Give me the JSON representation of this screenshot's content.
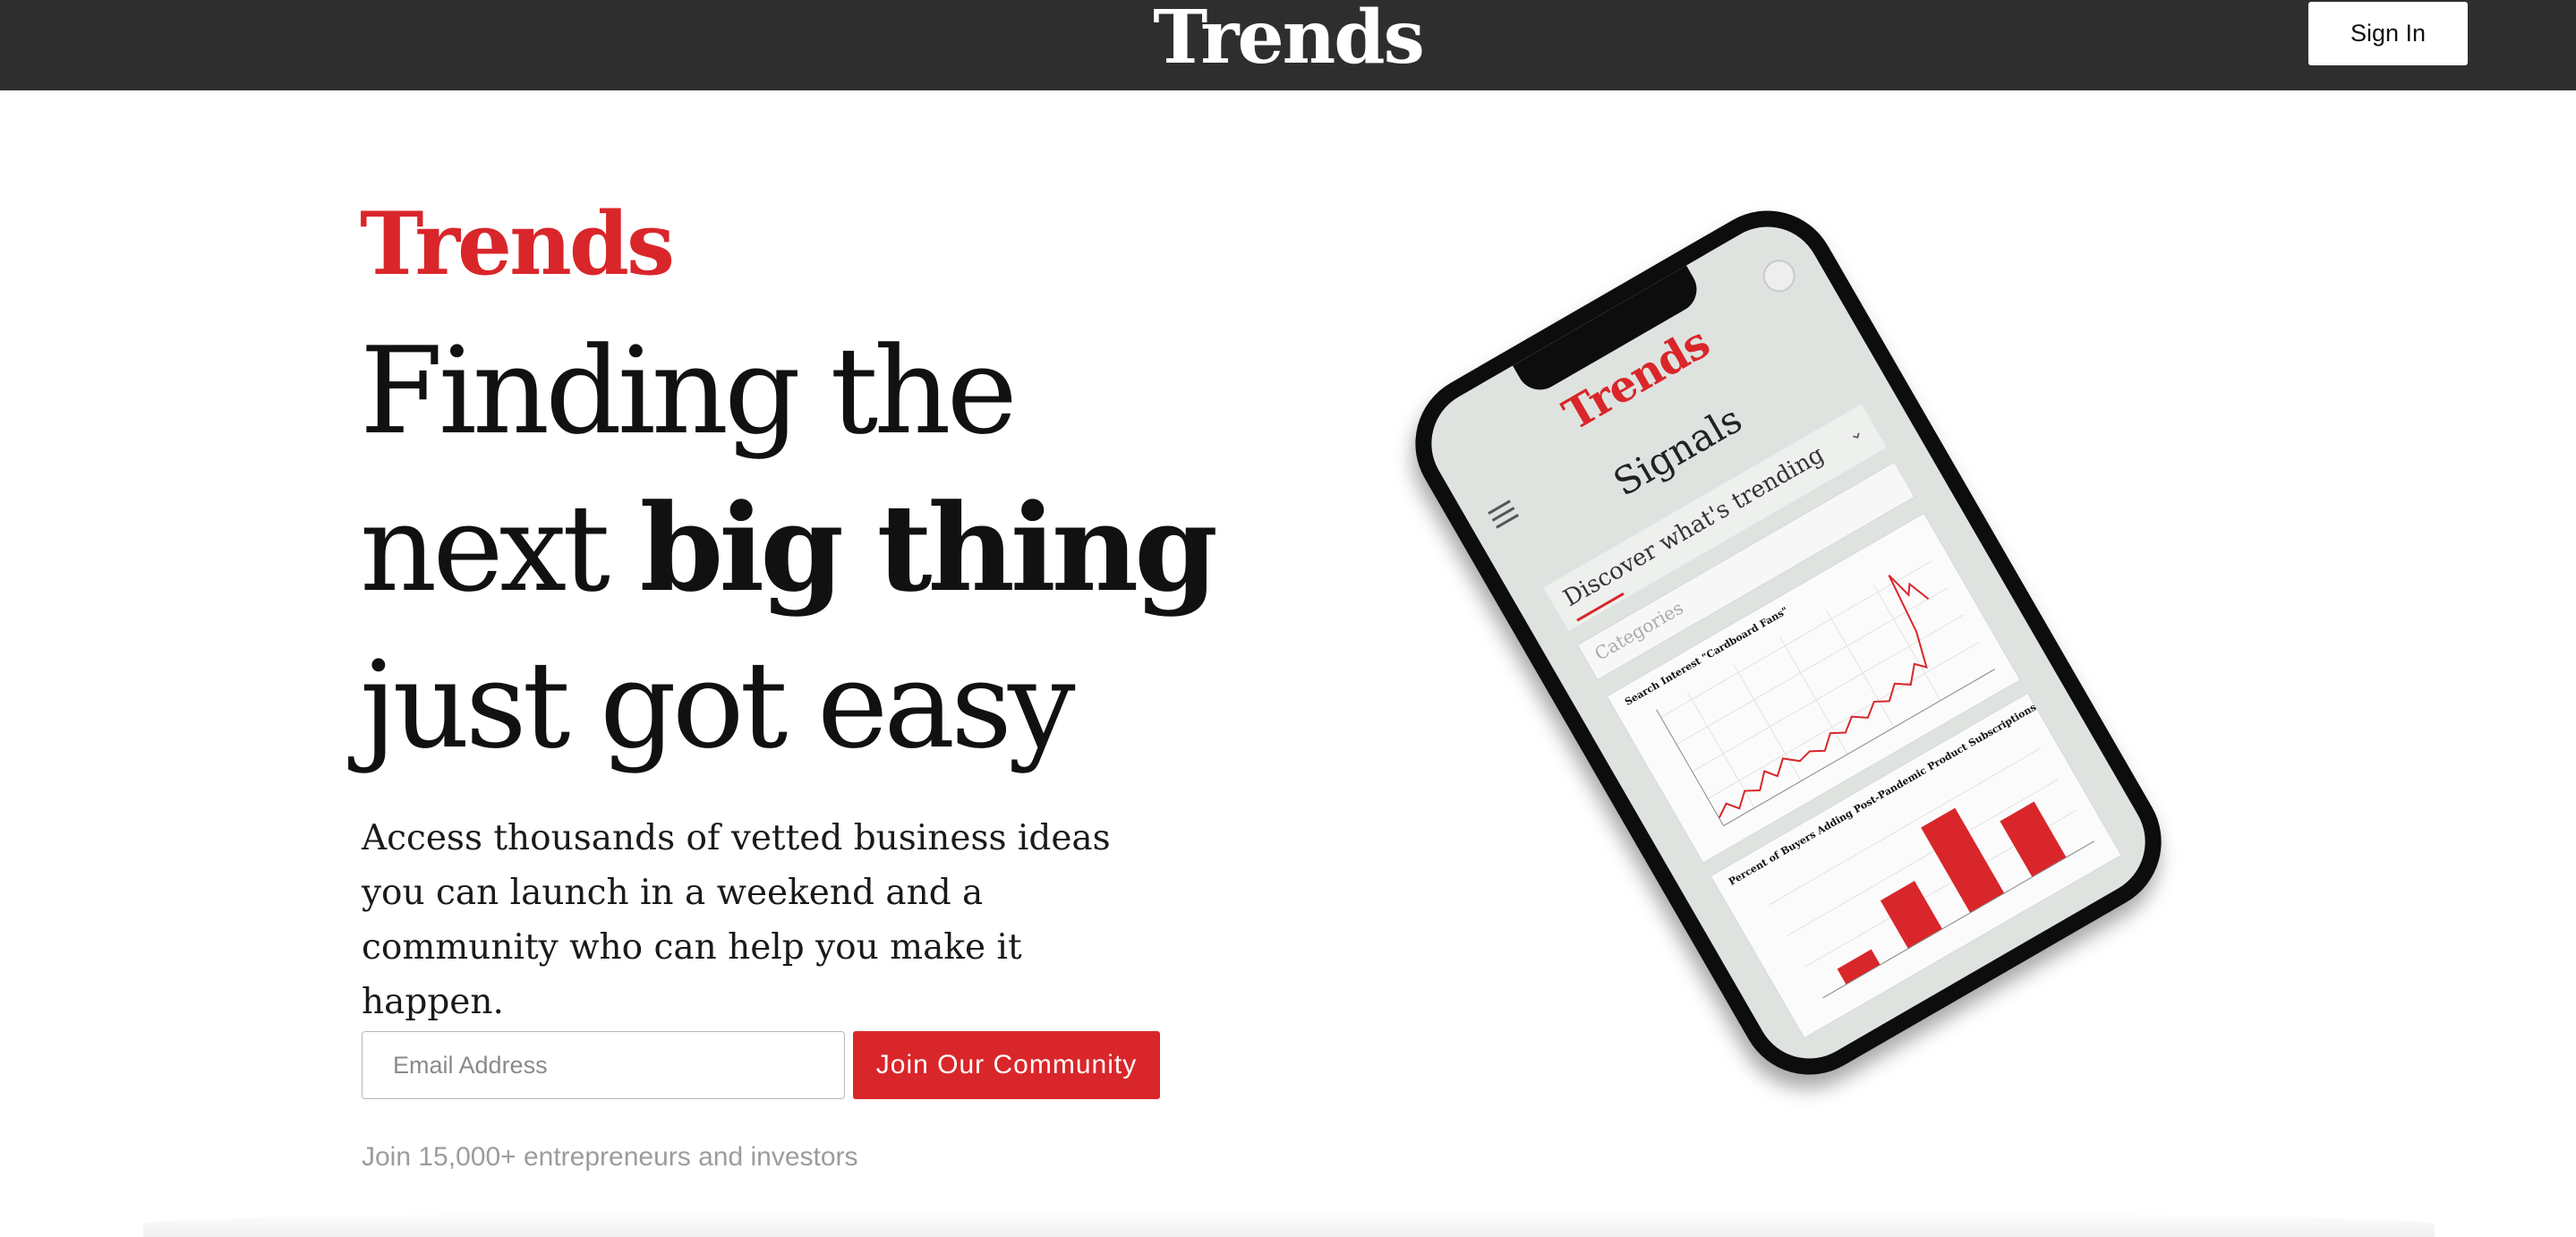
{
  "topbar": {
    "logo": "Trends",
    "sign_in_label": "Sign In"
  },
  "hero": {
    "brand": "Trends",
    "headline_line1": "Finding the",
    "headline_line2_pre": "next ",
    "headline_line2_bold": "big thing",
    "headline_line3": "just got easy",
    "subtext": "Access thousands of vetted business ideas you can launch in a weekend and a community who can help you make it happen.",
    "email_placeholder": "Email Address",
    "cta_label": "Join Our Community",
    "note": "Join 15,000+ entrepreneurs and investors"
  },
  "phone": {
    "logo": "Trends",
    "title": "Signals",
    "dropdown_label": "Discover what's trending",
    "categories_placeholder": "Categories",
    "chart1_title": "Search Interest \"Cardboard Fans\"",
    "chart2_title": "Percent of Buyers Adding Post-Pandemic Product Subscriptions"
  },
  "colors": {
    "brand_red": "#d9262a",
    "topbar_bg": "#2e2e2e"
  }
}
